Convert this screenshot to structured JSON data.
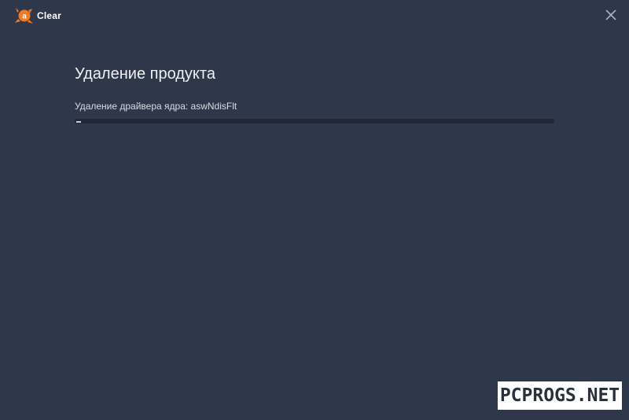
{
  "window": {
    "app_name": "Clear",
    "logo_icon": "avast-logo-icon",
    "close_icon": "close-icon",
    "accent_color": "#f47a20",
    "background_color": "#2f374b"
  },
  "main": {
    "title": "Удаление продукта",
    "status_text": "Удаление драйвера ядра: aswNdisFlt",
    "progress_fraction": 0.01
  },
  "watermark": {
    "text": "PCPROGS.NET"
  }
}
